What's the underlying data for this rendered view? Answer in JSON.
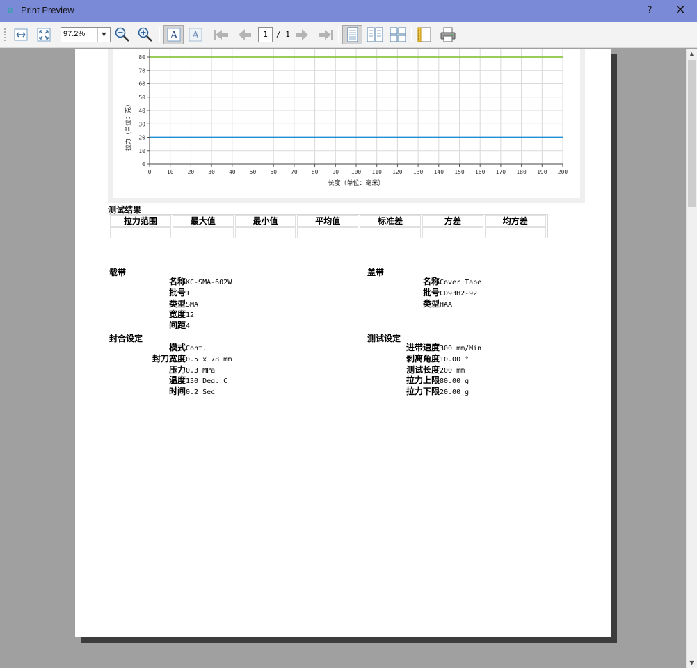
{
  "window": {
    "title": "Print Preview",
    "help_label": "?",
    "close_label": "✕"
  },
  "toolbar": {
    "zoom": "97.2%",
    "current_page": "1",
    "total_pages": "/ 1"
  },
  "chart_data": {
    "type": "line",
    "xlabel": "长度（单位：毫米）",
    "ylabel": "拉力（单位：克）",
    "x_ticks": [
      "0",
      "10",
      "20",
      "30",
      "40",
      "50",
      "60",
      "70",
      "80",
      "90",
      "100",
      "110",
      "120",
      "130",
      "140",
      "150",
      "160",
      "170",
      "180",
      "190",
      "200"
    ],
    "y_ticks": [
      "0",
      "10",
      "20",
      "30",
      "40",
      "50",
      "60",
      "70",
      "80"
    ],
    "xlim": [
      0,
      200
    ],
    "ylim": [
      0,
      80
    ],
    "grid": true,
    "series": [
      {
        "x": [
          0,
          200
        ],
        "values": [
          80,
          80
        ],
        "color": "#8cc63f"
      },
      {
        "x": [
          0,
          200
        ],
        "values": [
          20,
          20
        ],
        "color": "#1e8fd6"
      }
    ]
  },
  "results": {
    "title": "测试结果",
    "headers": [
      "拉力范围",
      "最大值",
      "最小值",
      "平均值",
      "标准差",
      "方差",
      "均方差"
    ],
    "values": [
      "",
      "",
      "",
      "",
      "",
      "",
      ""
    ]
  },
  "carrier": {
    "title": "载带",
    "rows": [
      {
        "label": "名称",
        "value": "KC-SMA-602W"
      },
      {
        "label": "批号",
        "value": "1"
      },
      {
        "label": "类型",
        "value": "SMA"
      },
      {
        "label": "宽度",
        "value": "12"
      },
      {
        "label": "间距",
        "value": "4"
      }
    ]
  },
  "cover": {
    "title": "盖带",
    "rows": [
      {
        "label": "名称",
        "value": "Cover Tape"
      },
      {
        "label": "批号",
        "value": "CD93H2-92"
      },
      {
        "label": "类型",
        "value": "HAA"
      }
    ]
  },
  "seal": {
    "title": "封合设定",
    "rows": [
      {
        "label": "模式",
        "value": "Cont."
      },
      {
        "label": "封刀宽度",
        "value": "0.5 x 78 mm"
      },
      {
        "label": "压力",
        "value": "0.3 MPa"
      },
      {
        "label": "温度",
        "value": "130 Deg. C"
      },
      {
        "label": "时间",
        "value": "0.2 Sec"
      }
    ]
  },
  "test": {
    "title": "测试设定",
    "rows": [
      {
        "label": "进带速度",
        "value": "300 mm/Min"
      },
      {
        "label": "剥离角度",
        "value": "10.00 °"
      },
      {
        "label": "测试长度",
        "value": "200 mm"
      },
      {
        "label": "拉力上限",
        "value": "80.00 g"
      },
      {
        "label": "拉力下限",
        "value": "20.00 g"
      }
    ]
  },
  "colors": {
    "titlebar": "#7b8ad6",
    "upper_limit": "#8cc63f",
    "lower_limit": "#1e8fd6"
  },
  "icons": [
    "app-icon",
    "fit-width-icon",
    "fit-page-icon",
    "zoom-out-icon",
    "zoom-in-icon",
    "font-a-icon",
    "font-a-outline-icon",
    "first-page-icon",
    "prev-page-icon",
    "next-page-icon",
    "last-page-icon",
    "single-page-icon",
    "two-pages-icon",
    "four-pages-icon",
    "page-setup-icon",
    "print-icon"
  ]
}
